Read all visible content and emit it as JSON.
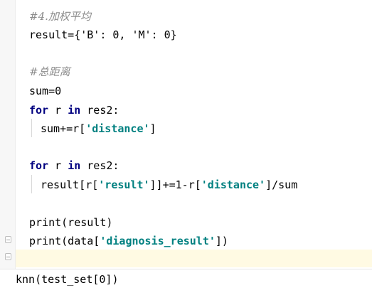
{
  "code": {
    "comment_weighted": "#4.加权平均",
    "result_init": "result={'B': 0, 'M': 0}",
    "comment_total": "#总距离",
    "sum_init": "sum=0",
    "for_kw": "for",
    "for_var": " r ",
    "in_kw": "in",
    "for_iter": " res2:",
    "sum_update_prefix": "sum+=r[",
    "distance_str": "'distance'",
    "close_bracket": "]",
    "result_update_prefix": "result[r[",
    "result_str": "'result'",
    "result_update_mid": "]]+=1-r[",
    "result_update_suffix": "]/sum",
    "print_result": "print(result)",
    "print_data_prefix": "print(data[",
    "diagnosis_str": "'diagnosis_result'",
    "print_data_suffix": "])"
  },
  "console": {
    "call": "knn(test_set[0])"
  }
}
